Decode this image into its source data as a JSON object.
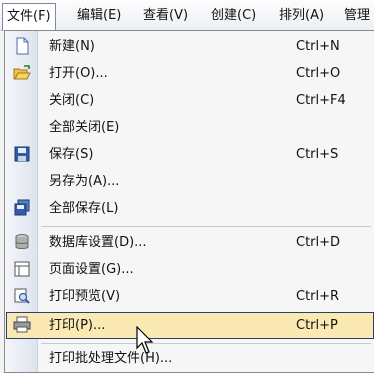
{
  "menubar": {
    "items": [
      {
        "label": "文件(F)"
      },
      {
        "label": "编辑(E)"
      },
      {
        "label": "查看(V)"
      },
      {
        "label": "创建(C)"
      },
      {
        "label": "排列(A)"
      },
      {
        "label": "管理"
      }
    ]
  },
  "file_menu": {
    "items": [
      {
        "label": "新建(N)",
        "shortcut": "Ctrl+N",
        "icon": "new-file-icon"
      },
      {
        "label": "打开(O)...",
        "shortcut": "Ctrl+O",
        "icon": "open-folder-icon"
      },
      {
        "label": "关闭(C)",
        "shortcut": "Ctrl+F4",
        "icon": ""
      },
      {
        "label": "全部关闭(E)",
        "shortcut": "",
        "icon": ""
      },
      {
        "label": "保存(S)",
        "shortcut": "Ctrl+S",
        "icon": "save-disk-icon"
      },
      {
        "label": "另存为(A)...",
        "shortcut": "",
        "icon": ""
      },
      {
        "label": "全部保存(L)",
        "shortcut": "",
        "icon": "save-all-icon"
      },
      {
        "label": "数据库设置(D)...",
        "shortcut": "Ctrl+D",
        "icon": "database-icon"
      },
      {
        "label": "页面设置(G)...",
        "shortcut": "",
        "icon": "page-setup-icon"
      },
      {
        "label": "打印预览(V)",
        "shortcut": "Ctrl+R",
        "icon": "print-preview-icon"
      },
      {
        "label": "打印(P)...",
        "shortcut": "Ctrl+P",
        "icon": "printer-icon",
        "highlighted": true
      },
      {
        "label": "打印批处理文件(H)...",
        "shortcut": "",
        "icon": ""
      }
    ]
  }
}
